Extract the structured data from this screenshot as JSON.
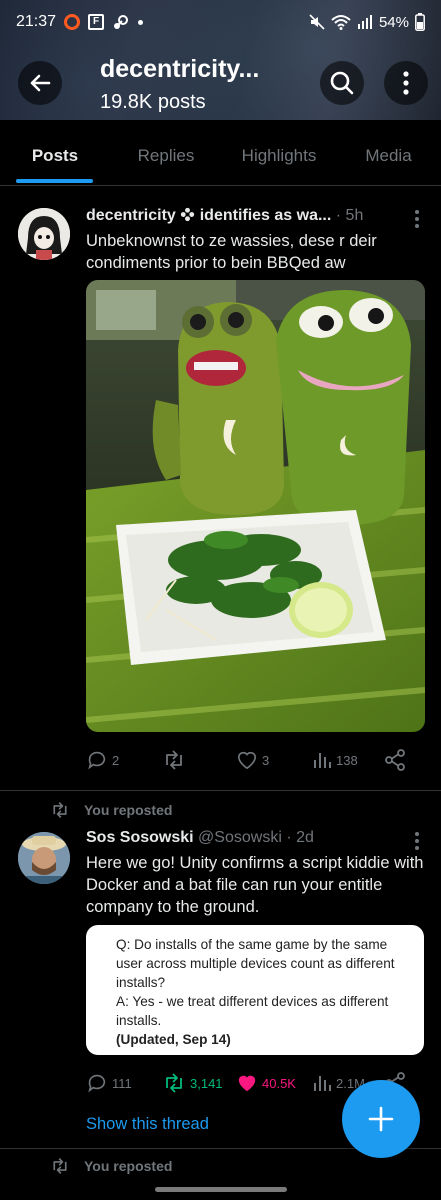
{
  "status_bar": {
    "time": "21:37",
    "battery": "54%",
    "icons": [
      "ring-icon",
      "f-box-icon",
      "steam-icon",
      "dot-icon",
      "mute-icon",
      "wifi-icon",
      "signal-icon",
      "battery-icon"
    ]
  },
  "header": {
    "title": "decentricity...",
    "subtitle": "19.8K posts"
  },
  "tabs": [
    {
      "label": "Posts",
      "active": true
    },
    {
      "label": "Replies",
      "active": false
    },
    {
      "label": "Highlights",
      "active": false
    },
    {
      "label": "Media",
      "active": false
    }
  ],
  "post1": {
    "name": "decentricity",
    "name_suffix": "identifies as wa...",
    "time": "· 5h",
    "text": "Unbeknownst to ze wassies, dese r deir condiments prior to bein BBQed aw",
    "replies": "2",
    "reposts": "",
    "likes": "3",
    "views": "138"
  },
  "post2": {
    "repost_label": "You reposted",
    "name": "Sos Sosowski",
    "handle": "@Sosowski",
    "time": "· 2d",
    "text": "Here we go! Unity confirms a script kiddie with Docker and a bat file can run your entitle company to the ground.",
    "quote": {
      "q": "Q: Do installs of the same game by the same user across multiple devices count as different installs?",
      "a": "A: Yes - we treat different devices as different installs.",
      "updated": "(Updated, Sep 14)"
    },
    "replies": "111",
    "reposts": "3,141",
    "likes": "40.5K",
    "views": "2.1M",
    "show_thread": "Show this thread"
  },
  "post3": {
    "repost_label": "You reposted"
  },
  "colors": {
    "accent": "#1d9bf0",
    "like": "#f91880",
    "repost": "#00ba7c",
    "muted": "#71767b"
  }
}
